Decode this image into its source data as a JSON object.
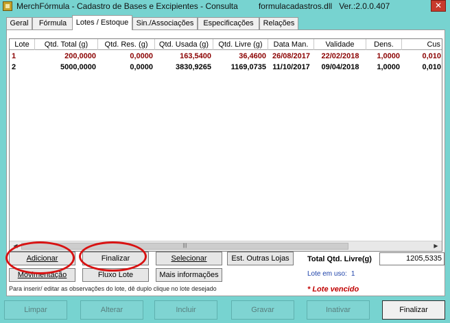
{
  "window": {
    "title": "MerchFórmula - Cadastro de Bases e Excipientes - Consulta",
    "dll": "formulacadastros.dll",
    "version": "Ver.:2.0.0.407",
    "close_glyph": "✕"
  },
  "tabs": [
    {
      "label": "Geral",
      "active": false
    },
    {
      "label": "Fórmula",
      "active": false
    },
    {
      "label": "Lotes / Estoque",
      "active": true
    },
    {
      "label": "Sin./Associações",
      "active": false
    },
    {
      "label": "Especificações",
      "active": false
    },
    {
      "label": "Relações",
      "active": false
    }
  ],
  "grid": {
    "columns": [
      "Lote",
      "Qtd. Total (g)",
      "Qtd. Res. (g)",
      "Qtd. Usada (g)",
      "Qtd. Livre (g)",
      "Data Man.",
      "Validade",
      "Dens.",
      "Cus"
    ],
    "rows": [
      {
        "lote": "1",
        "qtd_total": "200,0000",
        "qtd_res": "0,0000",
        "qtd_usada": "163,5400",
        "qtd_livre": "36,4600",
        "data_man": "26/08/2017",
        "validade": "22/02/2018",
        "dens": "1,0000",
        "cus": "0,010",
        "expired": true
      },
      {
        "lote": "2",
        "qtd_total": "5000,0000",
        "qtd_res": "0,0000",
        "qtd_usada": "3830,9265",
        "qtd_livre": "1169,0735",
        "data_man": "11/10/2017",
        "validade": "09/04/2018",
        "dens": "1,0000",
        "cus": "0,010",
        "expired": false
      }
    ],
    "scroll_left": "◀",
    "scroll_right": "▶",
    "scroll_grip": "|||"
  },
  "buttons": {
    "adicionar": "Adicionar",
    "finalizar_lote": "Finalizar",
    "selecionar": "Selecionar",
    "est_outras_lojas": "Est. Outras Lojas",
    "movimentacao": "Movimentação",
    "fluxo_lote": "Fluxo Lote",
    "mais_informacoes": "Mais informações"
  },
  "hint": "Para inserir/ editar as observações do lote, dê duplo clique no lote desejado",
  "total": {
    "label": "Total Qtd. Livre(g)",
    "value": "1205,5335"
  },
  "lote_em_uso": {
    "label": "Lote em uso:",
    "value": "1"
  },
  "lote_vencido": "* Lote vencido",
  "bottom_bar": {
    "limpar": "Limpar",
    "alterar": "Alterar",
    "incluir": "Incluir",
    "gravar": "Gravar",
    "inativar": "Inativar",
    "finalizar": "Finalizar"
  },
  "colors": {
    "window_bg": "#77d3d0",
    "expired_row": "#8b0000",
    "annotation": "#d81212",
    "lote_uso": "#1a3fa8",
    "vencido": "#c00000"
  }
}
